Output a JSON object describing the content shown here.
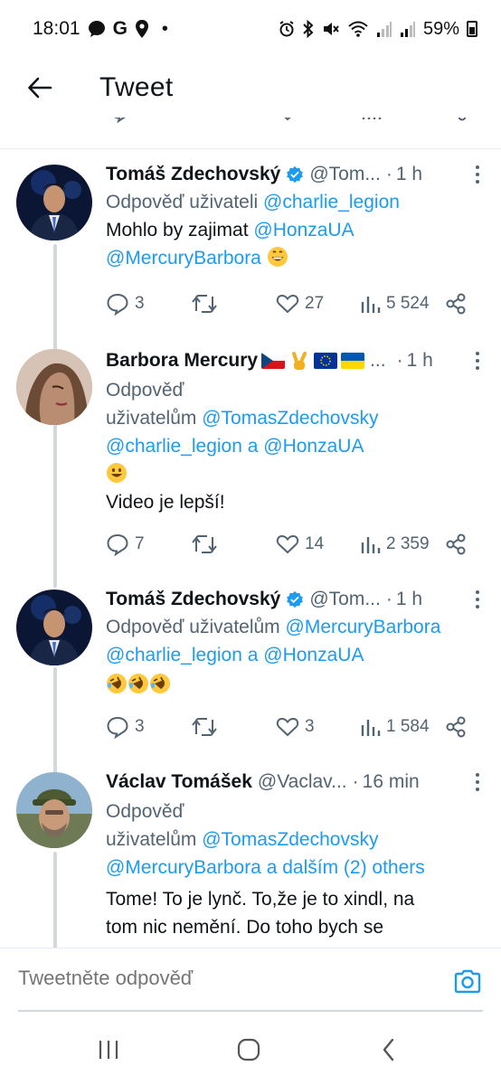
{
  "status_bar": {
    "time": "18:01",
    "g_letter": "G",
    "dot": "•",
    "battery": "59%"
  },
  "header": {
    "title": "Tweet"
  },
  "tweets": [
    {
      "name": "Tomáš Zdechovský",
      "handle": "@Tom...",
      "time": "1 h",
      "reply_prefix": "Odpověď uživateli",
      "reply_mentions": "@charlie_legion",
      "text_1": "Mohlo by zajimat",
      "mention_1": "@HonzaUA",
      "mention_2": "@MercuryBarbora",
      "replies": "3",
      "likes": "27",
      "views": "5 524"
    },
    {
      "name": "Barbora Mercury",
      "ellipsis": "...",
      "time": "1 h",
      "reply_line_1": "Odpověď",
      "reply_prefix": "uživatelům",
      "mention_1": "@TomasZdechovsky",
      "mention_2": "@charlie_legion a @HonzaUA",
      "text": "Video je lepší!",
      "replies": "7",
      "likes": "14",
      "views": "2 359"
    },
    {
      "name": "Tomáš Zdechovský",
      "handle": "@Tom...",
      "time": "1 h",
      "reply_prefix": "Odpověď uživatelům",
      "mention_1": "@MercuryBarbora",
      "mention_2": "@charlie_legion a @HonzaUA",
      "replies": "3",
      "likes": "3",
      "views": "1 584"
    },
    {
      "name": "Václav Tomášek",
      "handle": "@Vaclav...",
      "time": "16 min",
      "reply_line_1": "Odpověď",
      "reply_prefix": "uživatelům",
      "mention_1": "@TomasZdechovsky",
      "mention_2": "@MercuryBarbora a dalším (2) others",
      "text_1": "Tome! To je lynč. To,že je to xindl, na",
      "text_2": "tom nic nemění. Do toho bych se"
    }
  ],
  "compose": {
    "placeholder": "Tweetněte odpověď"
  },
  "colors": {
    "accent": "#1d9bf0",
    "secondary_text": "#536471",
    "thread_line": "#cfd9de"
  },
  "icons": [
    "back-arrow-icon",
    "verified-badge-icon",
    "reply-icon",
    "retweet-icon",
    "like-icon",
    "views-icon",
    "share-icon",
    "camera-icon",
    "more-icon"
  ]
}
